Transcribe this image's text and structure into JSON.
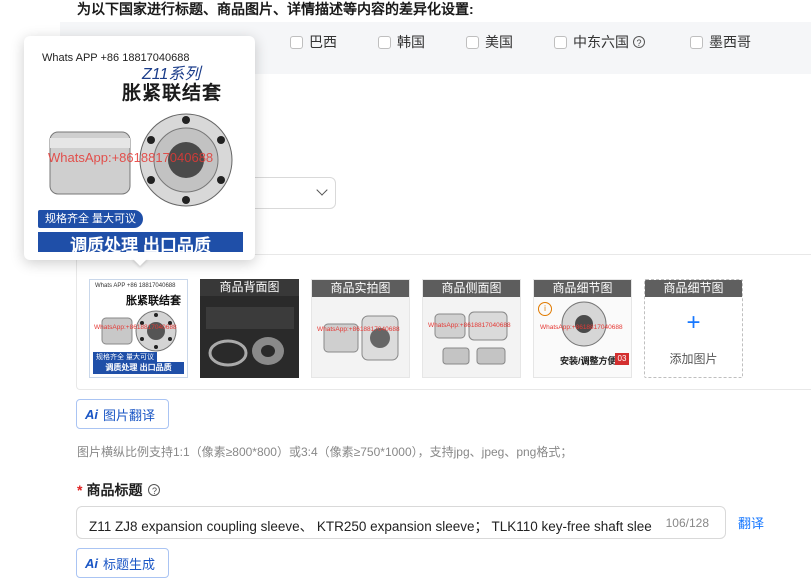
{
  "heading": "为以下国家进行标题、商品图片、详情描述等内容的差异化设置:",
  "countries": [
    {
      "label": "墨西哥",
      "key": "mexico"
    },
    {
      "label": "巴西",
      "key": "brazil"
    },
    {
      "label": "韩国",
      "key": "korea"
    },
    {
      "label": "美国",
      "key": "usa"
    },
    {
      "label": "中东六国",
      "key": "gcc"
    }
  ],
  "images": {
    "slots": [
      {
        "label": "",
        "wm": "WhatsApp:+8618817040688"
      },
      {
        "label": "商品背面图",
        "wm": ""
      },
      {
        "label": "商品实拍图",
        "wm": "WhatsApp:+8618817040688"
      },
      {
        "label": "商品侧面图",
        "wm": "WhatsApp:+8618817040688"
      },
      {
        "label": "商品细节图",
        "wm": "WhatsApp:+8618817040688",
        "subtext": "安装/调整方便",
        "num": "03"
      }
    ],
    "add_slot_label": "商品细节图",
    "add_text": "添加图片",
    "plus": "+"
  },
  "ai": {
    "image_translate": "图片翻译",
    "title_generate": "标题生成",
    "icon_text": "Ai"
  },
  "hint": "图片横纵比例支持1:1（像素≥800*800）或3:4（像素≥750*1000），支持jpg、jpeg、png格式；",
  "title_field": {
    "required_mark": "*",
    "label": "商品标题",
    "value": "Z11 ZJ8 expansion coupling sleeve、 KTR250 expansion sleeve； TLK110 key-free shaft slee",
    "count": "106/128",
    "translate": "翻译"
  },
  "popover": {
    "whatsapp": "Whats APP +86 18817040688",
    "series": "Z11系列",
    "title": "胀紧联结套",
    "watermark": "WhatsApp:+8618817040688",
    "badge": "规格齐全 量大可议",
    "bottom": "调质处理 出口品质"
  },
  "colors": {
    "accent": "#1677ff",
    "brand_blue": "#1f4fa8",
    "required": "#e02020"
  }
}
